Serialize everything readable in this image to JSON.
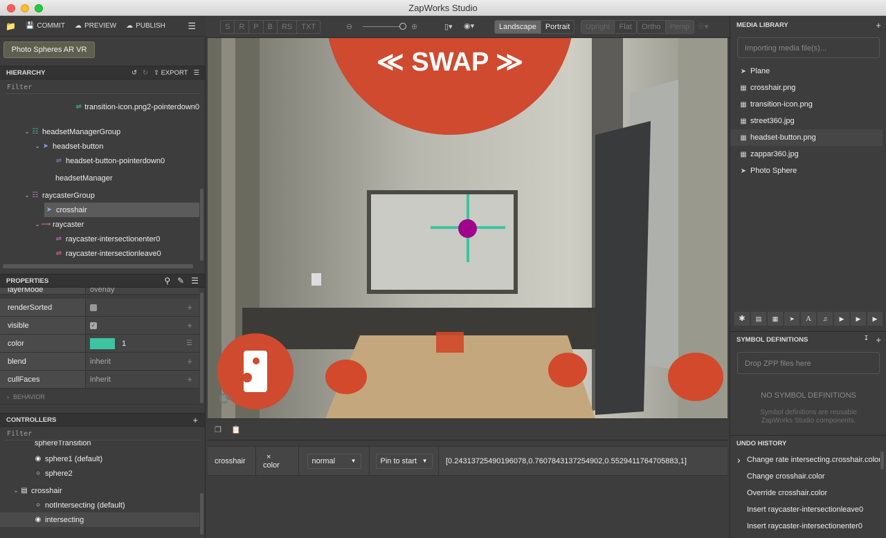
{
  "window": {
    "title": "ZapWorks Studio"
  },
  "toolbar_left": {
    "commit": "COMMIT",
    "preview": "PREVIEW",
    "publish": "PUBLISH"
  },
  "project": {
    "name": "Photo Spheres AR VR"
  },
  "hierarchy": {
    "title": "HIERARCHY",
    "export": "EXPORT",
    "filter_placeholder": "Filter",
    "items": [
      {
        "label": "transition-icon.png2-pointerdown0"
      },
      {
        "label": "headsetManagerGroup"
      },
      {
        "label": "headset-button"
      },
      {
        "label": "headset-button-pointerdown0"
      },
      {
        "label": "headsetManager"
      },
      {
        "label": "raycasterGroup"
      },
      {
        "label": "crosshair"
      },
      {
        "label": "raycaster"
      },
      {
        "label": "raycaster-intersectionenter0"
      },
      {
        "label": "raycaster-intersectionleave0"
      }
    ]
  },
  "properties": {
    "title": "PROPERTIES",
    "partial_top": "layerMode",
    "partial_top_value": "overlay",
    "rows": [
      {
        "name": "renderSorted",
        "value": ""
      },
      {
        "name": "visible",
        "value": ""
      },
      {
        "name": "color",
        "value": "1"
      },
      {
        "name": "blend",
        "value": "inherit"
      },
      {
        "name": "cullFaces",
        "value": "inherit"
      }
    ],
    "behavior_section": "BEHAVIOR",
    "color_swatch": "#3ec3a0"
  },
  "controllers": {
    "title": "CONTROLLERS",
    "filter_placeholder": "Filter",
    "partial_top": "sphereTransition",
    "items": [
      {
        "label": "sphere1 (default)"
      },
      {
        "label": "sphere2"
      },
      {
        "label": "crosshair"
      },
      {
        "label": "notIntersecting (default)"
      },
      {
        "label": "intersecting"
      }
    ]
  },
  "view_toolbar": {
    "mode_buttons": [
      "S",
      "R",
      "P",
      "B",
      "RS",
      "TXT"
    ],
    "landscape": "Landscape",
    "portrait": "Portrait",
    "upright": "Upright",
    "flat": "Flat",
    "ortho": "Ortho",
    "persp": "Persp"
  },
  "viewport": {
    "swap_label": "≪ SWAP ≫"
  },
  "timeline": {
    "node": "crosshair",
    "property": "color",
    "remove_icon": "×",
    "ease": "normal",
    "pin": "Pin to start",
    "value": "[0.24313725490196078,0.7607843137254902,0.5529411764705883,1]"
  },
  "media_library": {
    "title": "MEDIA LIBRARY",
    "import_placeholder": "Importing media file(s)...",
    "items": [
      {
        "label": "Plane",
        "icon": "rocket-icon"
      },
      {
        "label": "crosshair.png",
        "icon": "image-icon"
      },
      {
        "label": "transition-icon.png",
        "icon": "image-icon"
      },
      {
        "label": "street360.jpg",
        "icon": "image-icon"
      },
      {
        "label": "headset-button.png",
        "icon": "image-icon"
      },
      {
        "label": "zappar360.jpg",
        "icon": "image-icon"
      },
      {
        "label": "Photo Sphere",
        "icon": "rocket-icon"
      }
    ]
  },
  "symbols": {
    "title": "SYMBOL DEFINITIONS",
    "drop_placeholder": "Drop ZPP files here",
    "empty_title": "NO SYMBOL DEFINITIONS",
    "empty_desc": "Symbol definitions are reusable ZapWorks Studio components."
  },
  "undo_history": {
    "title": "UNDO HISTORY",
    "items": [
      {
        "label": "Change rate intersecting.crosshair.color"
      },
      {
        "label": "Change crosshair.color"
      },
      {
        "label": "Override crosshair.color"
      },
      {
        "label": "Insert raycaster-intersectionleave0"
      },
      {
        "label": "Insert raycaster-intersectionenter0"
      }
    ]
  },
  "colors": {
    "accent": "#3ec3a0",
    "swap_red": "#cf4a2f",
    "crosshair_dot": "#a0048a"
  }
}
